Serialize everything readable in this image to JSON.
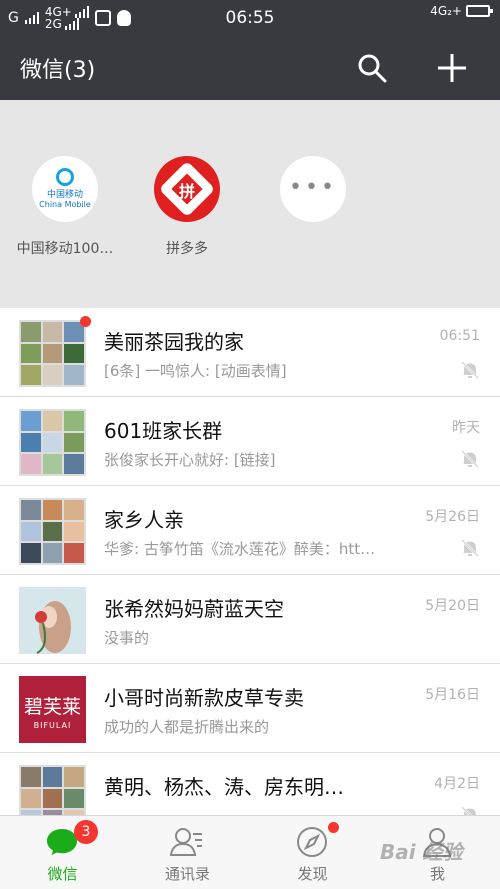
{
  "status_bar": {
    "carrier1": "G",
    "net_top": "4G+",
    "net_bottom": "2G",
    "time": "06:55",
    "right_net": "4G₂+"
  },
  "app_bar": {
    "title": "微信(3)",
    "search_icon": "search-icon",
    "add_icon": "plus-icon"
  },
  "mini_programs": [
    {
      "label": "中国移动100…",
      "icon_text_cn": "中国移动",
      "icon_text_en": "China Mobile"
    },
    {
      "label": "拼多多",
      "icon_text": "拼"
    },
    {
      "label": "",
      "icon_text": "•••"
    }
  ],
  "chats": [
    {
      "name": "美丽茶园我的家",
      "message": "[6条] 一鸣惊人: [动画表情]",
      "time": "06:51",
      "unread_dot": true,
      "muted": true,
      "avatar": "group"
    },
    {
      "name": "601班家长群",
      "message": "张俊家长开心就好: [链接]",
      "time": "昨天",
      "unread_dot": false,
      "muted": true,
      "avatar": "group"
    },
    {
      "name": "家乡人亲",
      "message": "华爹: 古筝竹笛《流水莲花》醉美：htt…",
      "time": "5月26日",
      "unread_dot": false,
      "muted": true,
      "avatar": "group"
    },
    {
      "name": "张希然妈妈蔚蓝天空",
      "message": "没事的",
      "time": "5月20日",
      "unread_dot": false,
      "muted": false,
      "avatar": "portrait"
    },
    {
      "name": "小哥时尚新款皮草专卖",
      "message": "成功的人都是折腾出来的",
      "time": "5月16日",
      "unread_dot": false,
      "muted": false,
      "avatar": "brand",
      "avatar_text": "碧芙莱",
      "avatar_subtext": "BIFULAI"
    },
    {
      "name": "黄明、杨杰、涛、房东明…",
      "message": "",
      "time": "4月2日",
      "unread_dot": false,
      "muted": true,
      "avatar": "group"
    }
  ],
  "tabs": [
    {
      "label": "微信",
      "icon": "chat-bubble-icon",
      "badge": "3",
      "active": true
    },
    {
      "label": "通讯录",
      "icon": "contacts-icon",
      "badge": "",
      "active": false
    },
    {
      "label": "发现",
      "icon": "compass-icon",
      "badge": "",
      "active": false,
      "dot": true
    },
    {
      "label": "我",
      "icon": "person-icon",
      "badge": "",
      "active": false
    }
  ],
  "watermark": "Bai 经验",
  "colors": {
    "header": "#393a3f",
    "accent_green": "#1aad19",
    "badge_red": "#f43530",
    "pinduoduo_red": "#e02020"
  }
}
